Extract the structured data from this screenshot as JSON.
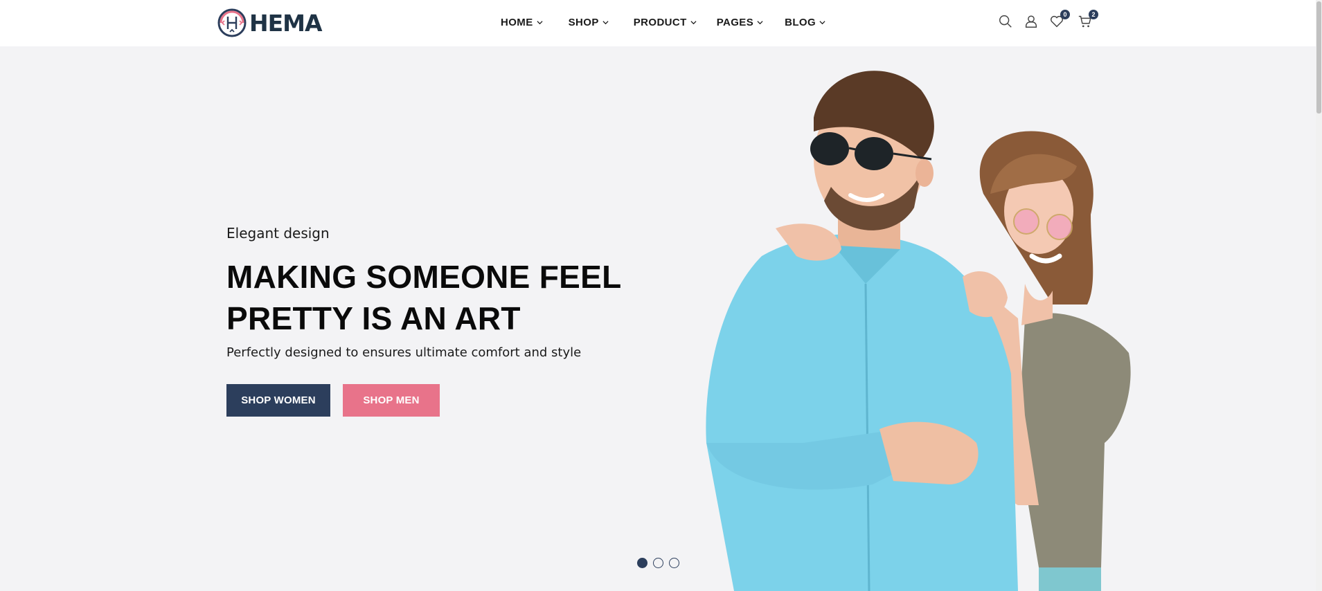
{
  "header": {
    "logo_text": "HEMA",
    "nav": [
      {
        "label": "HOME"
      },
      {
        "label": "SHOP"
      },
      {
        "label": "PRODUCT"
      },
      {
        "label": "PAGES"
      },
      {
        "label": "BLOG"
      }
    ],
    "wishlist_count": "0",
    "cart_count": "2"
  },
  "hero": {
    "eyebrow": "Elegant design",
    "headline_line1": "MAKING SOMEONE FEEL",
    "headline_line2": "PRETTY IS AN ART",
    "subline": "Perfectly designed to ensures ultimate comfort and style",
    "btn_women": "SHOP WOMEN",
    "btn_men": "SHOP MEN"
  },
  "slider": {
    "active_index": 1,
    "count": 3
  },
  "colors": {
    "brand_navy": "#2c3e5c",
    "brand_pink": "#e8738a",
    "logo_text": "#1f3345",
    "hero_bg": "#f3f3f5"
  },
  "icons": [
    "search-icon",
    "user-icon",
    "heart-icon",
    "cart-icon",
    "chevron-down-icon"
  ]
}
